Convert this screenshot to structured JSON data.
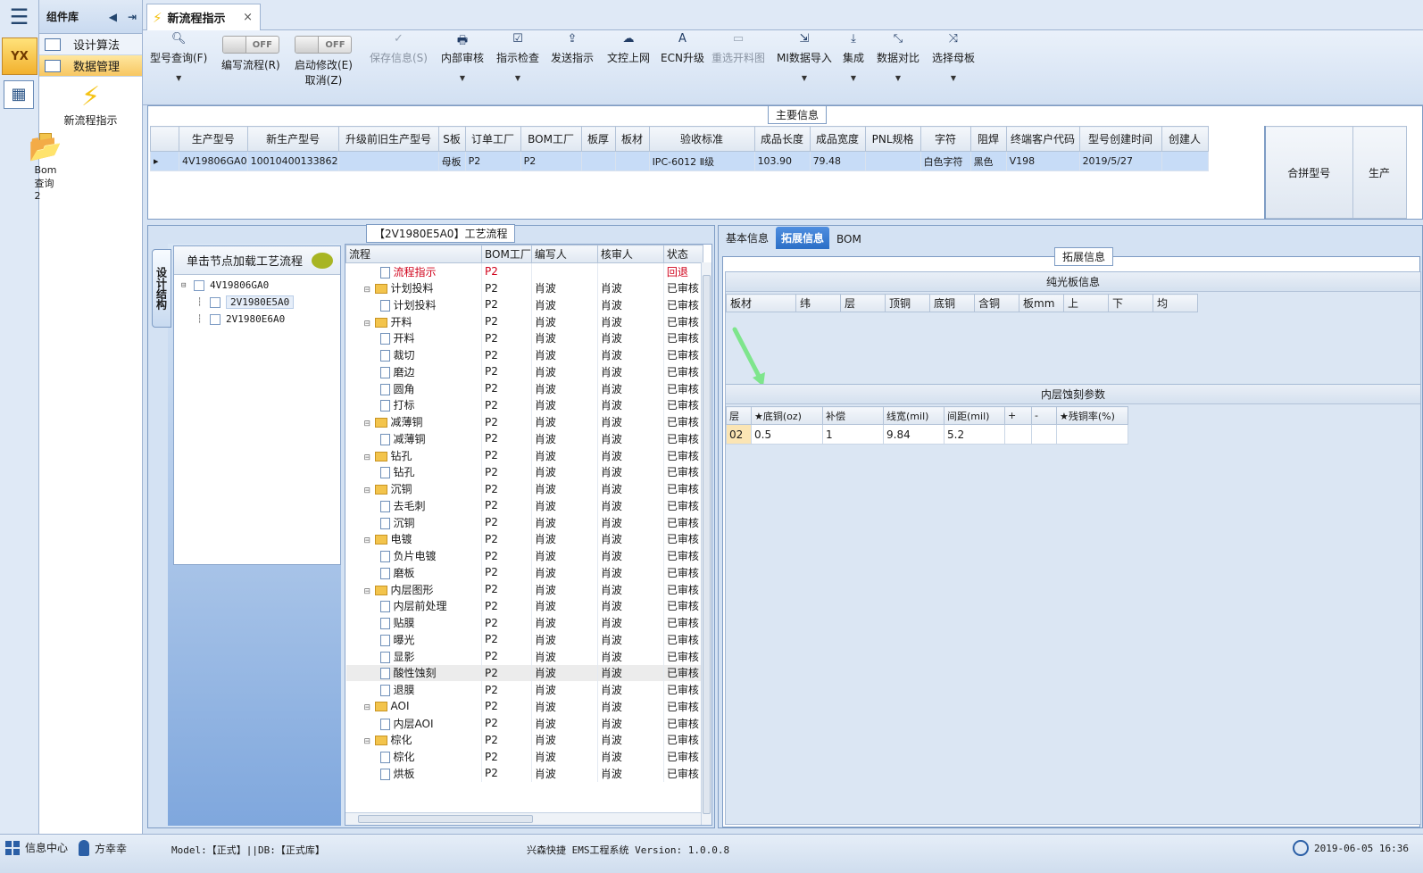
{
  "app": {
    "logo_text": "YX",
    "menu_icon": "hamburger-icon"
  },
  "component_panel": {
    "title": "组件库",
    "nav": [
      {
        "label": "设计算法",
        "active": false
      },
      {
        "label": "数据管理",
        "active": true
      }
    ],
    "tools": [
      {
        "label": "新流程指示",
        "icon": "lightning-icon"
      },
      {
        "label": "Bom查询2",
        "icon": "folder-open-icon"
      }
    ]
  },
  "tab": {
    "label": "新流程指示",
    "close": "×"
  },
  "toolbar": {
    "model_query": "型号查询(F)",
    "edit_flow": "编写流程(R)",
    "edit_flow_toggle": "OFF",
    "start_modify": "启动修改(E)",
    "start_modify_sub": "取消(Z)",
    "start_modify_toggle": "OFF",
    "save_info": "保存信息(S)",
    "internal_review": "内部审核",
    "indication_check": "指示检查",
    "send_indication": "发送指示",
    "doc_upload": "文控上网",
    "ecn_upgrade": "ECN升级",
    "reselect_cutting": "重选开料图",
    "mi_import": "MI数据导入",
    "integrate": "集成",
    "data_compare": "数据对比",
    "select_mother": "选择母板"
  },
  "main_info": {
    "caption": "主要信息",
    "columns": [
      "生产型号",
      "新生产型号",
      "升级前旧生产型号",
      "S板",
      "订单工厂",
      "BOM工厂",
      "板厚",
      "板材",
      "验收标准",
      "成品长度",
      "成品宽度",
      "PNL规格",
      "字符",
      "阻焊",
      "终端客户代码",
      "型号创建时间",
      "创建人"
    ],
    "rows": [
      [
        "4V19806GA0",
        "10010400133862",
        "",
        "母板",
        "P2",
        "P2",
        "",
        "",
        "IPC-6012 Ⅱ级",
        "103.90",
        "79.48",
        "",
        "白色字符",
        "黑色",
        "V198",
        "2019/5/27",
        ""
      ]
    ],
    "merge_columns": [
      "合拼型号",
      "生产"
    ]
  },
  "process_panel": {
    "caption": "【2V1980E5A0】工艺流程",
    "vertical_tab": "设计结构",
    "tree_header": "单击节点加载工艺流程",
    "tree": [
      {
        "label": "4V19806GA0",
        "level": 0,
        "selected": false
      },
      {
        "label": "2V1980E5A0",
        "level": 1,
        "selected": true
      },
      {
        "label": "2V1980E6A0",
        "level": 1,
        "selected": false
      }
    ],
    "columns": [
      "流程",
      "BOM工厂",
      "编写人",
      "核审人",
      "状态"
    ],
    "rows": [
      {
        "name": "流程指示",
        "type": "doc",
        "level": 1,
        "bom": "P2",
        "writer": "",
        "reviewer": "",
        "status": "回退",
        "red": true
      },
      {
        "name": "计划投料",
        "type": "folder",
        "level": 0,
        "bom": "P2",
        "writer": "肖波",
        "reviewer": "肖波",
        "status": "已审核"
      },
      {
        "name": "计划投料",
        "type": "doc",
        "level": 1,
        "bom": "P2",
        "writer": "肖波",
        "reviewer": "肖波",
        "status": "已审核"
      },
      {
        "name": "开料",
        "type": "folder",
        "level": 0,
        "bom": "P2",
        "writer": "肖波",
        "reviewer": "肖波",
        "status": "已审核"
      },
      {
        "name": "开料",
        "type": "doc",
        "level": 1,
        "bom": "P2",
        "writer": "肖波",
        "reviewer": "肖波",
        "status": "已审核"
      },
      {
        "name": "裁切",
        "type": "doc",
        "level": 1,
        "bom": "P2",
        "writer": "肖波",
        "reviewer": "肖波",
        "status": "已审核"
      },
      {
        "name": "磨边",
        "type": "doc",
        "level": 1,
        "bom": "P2",
        "writer": "肖波",
        "reviewer": "肖波",
        "status": "已审核"
      },
      {
        "name": "圆角",
        "type": "doc",
        "level": 1,
        "bom": "P2",
        "writer": "肖波",
        "reviewer": "肖波",
        "status": "已审核"
      },
      {
        "name": "打标",
        "type": "doc",
        "level": 1,
        "bom": "P2",
        "writer": "肖波",
        "reviewer": "肖波",
        "status": "已审核"
      },
      {
        "name": "减薄铜",
        "type": "folder",
        "level": 0,
        "bom": "P2",
        "writer": "肖波",
        "reviewer": "肖波",
        "status": "已审核"
      },
      {
        "name": "减薄铜",
        "type": "doc",
        "level": 1,
        "bom": "P2",
        "writer": "肖波",
        "reviewer": "肖波",
        "status": "已审核"
      },
      {
        "name": "钻孔",
        "type": "folder",
        "level": 0,
        "bom": "P2",
        "writer": "肖波",
        "reviewer": "肖波",
        "status": "已审核"
      },
      {
        "name": "钻孔",
        "type": "doc",
        "level": 1,
        "bom": "P2",
        "writer": "肖波",
        "reviewer": "肖波",
        "status": "已审核"
      },
      {
        "name": "沉铜",
        "type": "folder",
        "level": 0,
        "bom": "P2",
        "writer": "肖波",
        "reviewer": "肖波",
        "status": "已审核"
      },
      {
        "name": "去毛刺",
        "type": "doc",
        "level": 1,
        "bom": "P2",
        "writer": "肖波",
        "reviewer": "肖波",
        "status": "已审核"
      },
      {
        "name": "沉铜",
        "type": "doc",
        "level": 1,
        "bom": "P2",
        "writer": "肖波",
        "reviewer": "肖波",
        "status": "已审核"
      },
      {
        "name": "电镀",
        "type": "folder",
        "level": 0,
        "bom": "P2",
        "writer": "肖波",
        "reviewer": "肖波",
        "status": "已审核"
      },
      {
        "name": "负片电镀",
        "type": "doc",
        "level": 1,
        "bom": "P2",
        "writer": "肖波",
        "reviewer": "肖波",
        "status": "已审核"
      },
      {
        "name": "磨板",
        "type": "doc",
        "level": 1,
        "bom": "P2",
        "writer": "肖波",
        "reviewer": "肖波",
        "status": "已审核"
      },
      {
        "name": "内层图形",
        "type": "folder",
        "level": 0,
        "bom": "P2",
        "writer": "肖波",
        "reviewer": "肖波",
        "status": "已审核"
      },
      {
        "name": "内层前处理",
        "type": "doc",
        "level": 1,
        "bom": "P2",
        "writer": "肖波",
        "reviewer": "肖波",
        "status": "已审核"
      },
      {
        "name": "贴膜",
        "type": "doc",
        "level": 1,
        "bom": "P2",
        "writer": "肖波",
        "reviewer": "肖波",
        "status": "已审核"
      },
      {
        "name": "曝光",
        "type": "doc",
        "level": 1,
        "bom": "P2",
        "writer": "肖波",
        "reviewer": "肖波",
        "status": "已审核"
      },
      {
        "name": "显影",
        "type": "doc",
        "level": 1,
        "bom": "P2",
        "writer": "肖波",
        "reviewer": "肖波",
        "status": "已审核"
      },
      {
        "name": "酸性蚀刻",
        "type": "doc",
        "level": 1,
        "bom": "P2",
        "writer": "肖波",
        "reviewer": "肖波",
        "status": "已审核",
        "highlight": true
      },
      {
        "name": "退膜",
        "type": "doc",
        "level": 1,
        "bom": "P2",
        "writer": "肖波",
        "reviewer": "肖波",
        "status": "已审核"
      },
      {
        "name": "AOI",
        "type": "folder",
        "level": 0,
        "bom": "P2",
        "writer": "肖波",
        "reviewer": "肖波",
        "status": "已审核"
      },
      {
        "name": "内层AOI",
        "type": "doc",
        "level": 1,
        "bom": "P2",
        "writer": "肖波",
        "reviewer": "肖波",
        "status": "已审核"
      },
      {
        "name": "棕化",
        "type": "folder",
        "level": 0,
        "bom": "P2",
        "writer": "肖波",
        "reviewer": "肖波",
        "status": "已审核"
      },
      {
        "name": "棕化",
        "type": "doc",
        "level": 1,
        "bom": "P2",
        "writer": "肖波",
        "reviewer": "肖波",
        "status": "已审核"
      },
      {
        "name": "烘板",
        "type": "doc",
        "level": 1,
        "bom": "P2",
        "writer": "肖波",
        "reviewer": "肖波",
        "status": "已审核"
      }
    ]
  },
  "detail_panel": {
    "tabs": [
      {
        "label": "基本信息",
        "active": false
      },
      {
        "label": "拓展信息",
        "active": true
      },
      {
        "label": "BOM",
        "active": false
      }
    ],
    "caption": "拓展信息",
    "bare_board": {
      "title": "纯光板信息",
      "columns": [
        "板材",
        "纬",
        "层",
        "顶铜",
        "底铜",
        "含铜",
        "板mm",
        "上",
        "下",
        "均"
      ]
    },
    "inner_etch": {
      "title": "内层蚀刻参数",
      "columns": [
        "层",
        "★底铜(oz)",
        "补偿",
        "线宽(mil)",
        "间距(mil)",
        "+",
        "-",
        "★残铜率(%)"
      ],
      "rows": [
        [
          "02",
          "0.5",
          "1",
          "9.84",
          "5.2",
          "",
          "",
          ""
        ]
      ]
    }
  },
  "status_bar": {
    "info_center": "信息中心",
    "user": "方幸幸",
    "model": "Model:【正式】||DB:【正式库】",
    "system": "兴森快捷 EMS工程系统 Version: 1.0.0.8",
    "datetime": "2019-06-05 16:36"
  }
}
